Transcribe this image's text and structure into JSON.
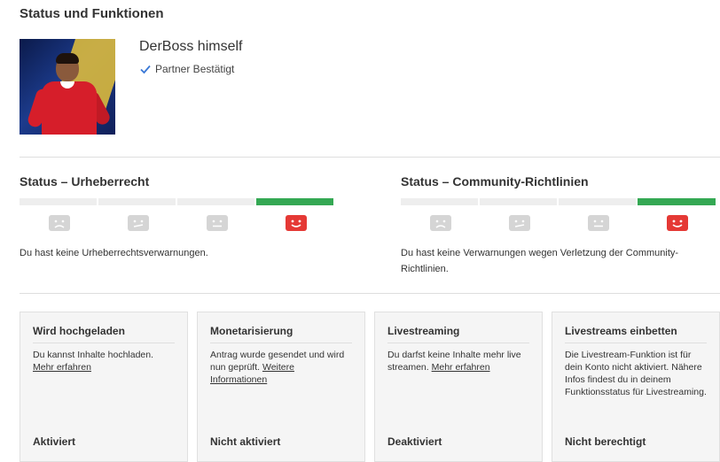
{
  "page": {
    "title": "Status und Funktionen"
  },
  "channel": {
    "name": "DerBoss himself",
    "partner_label": "Partner Bestätigt"
  },
  "copyright": {
    "title": "Status – Urheberrecht",
    "message": "Du hast keine Urheberrechtsverwarnungen."
  },
  "community": {
    "title": "Status – Community-Richtlinien",
    "message_line1": "Du hast keine Verwarnungen wegen Verletzung der Community-",
    "message_line2": "Richtlinien."
  },
  "colors": {
    "active_bar": "#34a853",
    "happy_face": "#e53935",
    "inactive_face": "#d5d5d5"
  },
  "icons": [
    "check-icon",
    "face-sad-icon",
    "face-skeptical-icon",
    "face-neutral-icon",
    "face-happy-icon"
  ],
  "cards": [
    {
      "title": "Wird hochgeladen",
      "desc": "Du kannst Inhalte hochladen.",
      "link": "Mehr erfahren",
      "status": "Aktiviert"
    },
    {
      "title": "Monetarisierung",
      "desc": "Antrag wurde gesendet und wird nun geprüft.",
      "link": "Weitere Informationen",
      "status": "Nicht aktiviert"
    },
    {
      "title": "Livestreaming",
      "desc": "Du darfst keine Inhalte mehr live streamen.",
      "link": "Mehr erfahren",
      "status": "Deaktiviert"
    },
    {
      "title": "Livestreams einbetten",
      "desc": "Die Livestream-Funktion ist für dein Konto nicht aktiviert. Nähere Infos findest du in deinem Funktionsstatus für Livestreaming.",
      "link": "",
      "status": "Nicht berechtigt"
    }
  ]
}
